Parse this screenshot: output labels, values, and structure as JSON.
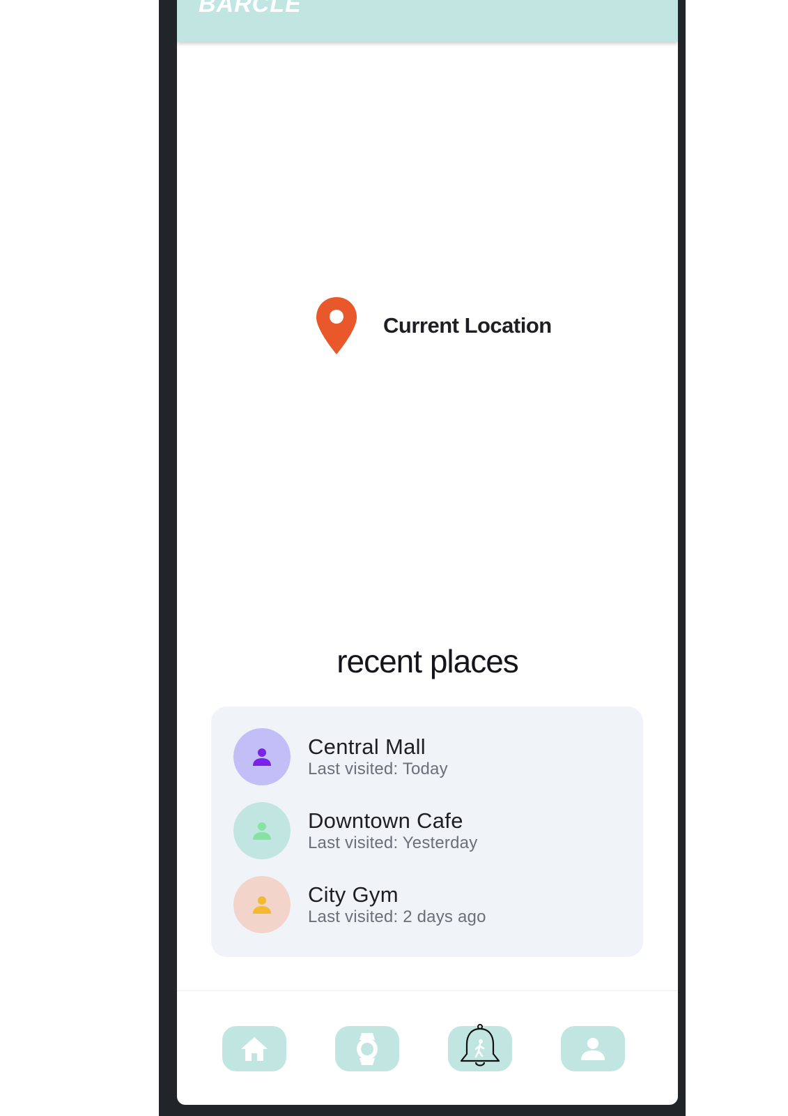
{
  "header": {
    "app_title": "BARCLE",
    "color": "#c1e6e2"
  },
  "map": {
    "location_label": "Current Location",
    "pin_icon": "map-pin-icon",
    "pin_color": "#e8582b"
  },
  "recent": {
    "title": "recent places",
    "places": [
      {
        "name": "Central Mall",
        "subtitle": "Last visited: Today",
        "icon": "person-icon",
        "avatar_bg": "#c1bff5",
        "icon_color": "#7a22e8"
      },
      {
        "name": "Downtown Cafe",
        "subtitle": "Last visited: Yesterday",
        "icon": "person-icon",
        "avatar_bg": "#c1e6e2",
        "icon_color": "#86e3a4"
      },
      {
        "name": "City Gym",
        "subtitle": "Last visited: 2 days ago",
        "icon": "person-icon",
        "avatar_bg": "#f3d4cb",
        "icon_color": "#f3ba2f"
      }
    ]
  },
  "nav": {
    "items": [
      {
        "name": "home",
        "icon": "home-icon"
      },
      {
        "name": "watch",
        "icon": "watch-icon"
      },
      {
        "name": "alerts",
        "icon": "bell-icon"
      },
      {
        "name": "profile",
        "icon": "person-icon"
      }
    ]
  }
}
